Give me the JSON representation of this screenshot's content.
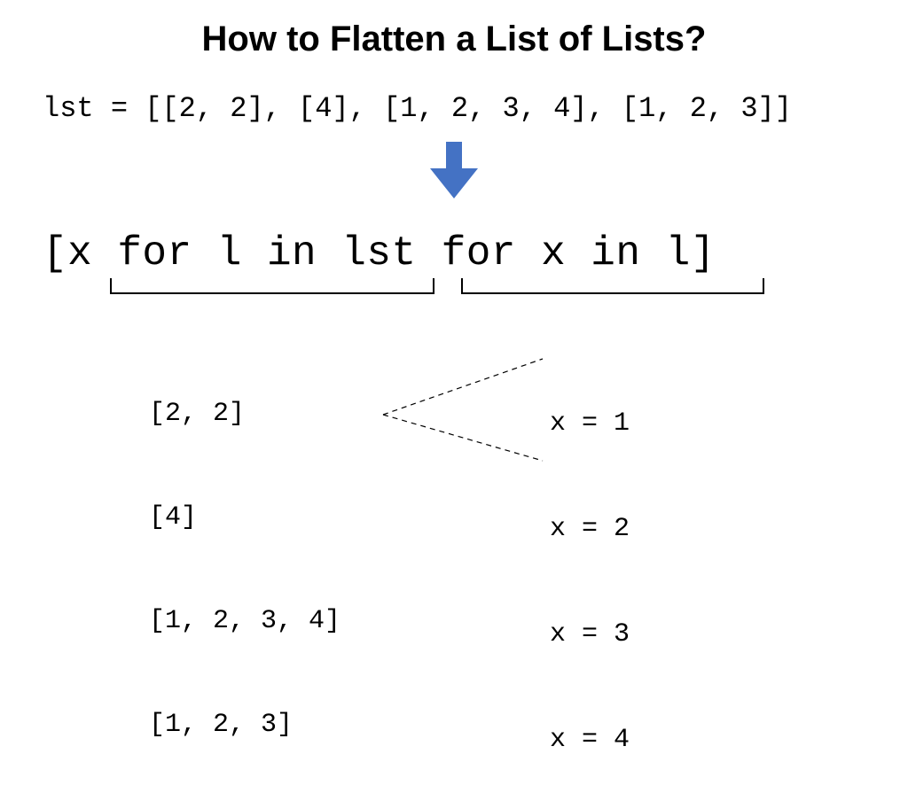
{
  "title": "How to Flatten a List of Lists?",
  "lst_def": "lst = [[2, 2], [4], [1, 2, 3, 4], [1, 2, 3]]",
  "comprehension": "[x for l in lst for x in l]",
  "left_expansion": [
    "[2, 2]",
    "[4]",
    "[1, 2, 3, 4]",
    "[1, 2, 3]"
  ],
  "right_expansion": [
    "x = 1",
    "x = 2",
    "x = 3",
    "x = 4"
  ],
  "arrow_color": "#4472C4"
}
